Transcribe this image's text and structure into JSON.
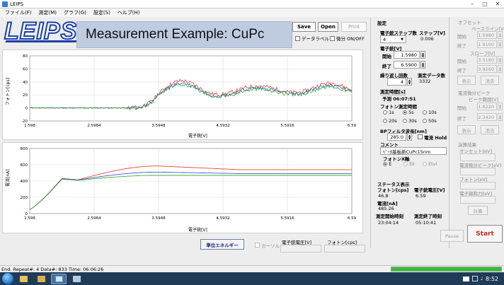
{
  "window": {
    "title": "LEIPS"
  },
  "menu": [
    "ファイル(F)",
    "測定(M)",
    "グラフ(G)",
    "設定(S)",
    "ヘルプ(H)"
  ],
  "logo": "LEIPS",
  "banner": "Measurement Example: CuPc",
  "toolbar": {
    "save": "Save",
    "open": "Open",
    "print": "Print",
    "data_label": "データラベル",
    "derivative": "微分 ON/OFF"
  },
  "upper_plot": {
    "ylabel": "フォトン[cps]",
    "xlabel": "電子銃[V]",
    "yticks": [
      "80",
      "60",
      "40",
      "20",
      "0",
      "-20"
    ],
    "xticks": [
      "1.598",
      "2.5964",
      "3.5948",
      "4.5932",
      "5.5916",
      "6.59"
    ]
  },
  "lower_plot": {
    "ylabel": "電流[nA]",
    "xlabel": "電子銃[V]",
    "yticks": [
      "800",
      "600",
      "400",
      "200",
      "0"
    ],
    "xticks": [
      "1.598",
      "2.5964",
      "3.5948",
      "4.5932",
      "5.5916",
      "6.59"
    ]
  },
  "bottom_bar": {
    "vacuum_button": "準位エネルギー",
    "cursor": "カーソル",
    "egun_voltage": "電子銃電圧[V]",
    "photon": "フォトン[cps]"
  },
  "settings": {
    "header": "設定",
    "egun_steps_label": "電子銃ステップ数",
    "steps_value": "4",
    "step_v_label": "ステップ[V]",
    "step_v_value": "0.006",
    "egun_v_label": "電子銃[V]",
    "start_label": "開始",
    "start_value": "1.5980",
    "end_label": "終了",
    "end_value": "6.5900",
    "repeat_label": "繰り返し回数",
    "repeat_value": "4",
    "data_count_label": "測定データ数",
    "data_count_value": "3332",
    "meas_time_label": "測定時間[s]",
    "forecast_label": "予測 06:07:51",
    "photon_time_label": "フォトン測定時間",
    "times": [
      "1s",
      "5s",
      "10s",
      "20s",
      "30s",
      "50s"
    ],
    "bp_label": "BPフィルタ波長[nm]",
    "bp_value": "285.0",
    "current_hold": "電流 Hold",
    "comment_label": "コメント",
    "comment_value": "ﾍﾟｰﾀ基板新CuPc15nm",
    "photon_x_label": "フォトンX軸",
    "photon_x_options": [
      "E",
      "Ek",
      "Etvl"
    ]
  },
  "status": {
    "header": "ステータス表示",
    "photon_label": "フォトン[cps]",
    "photon_value": "46.8",
    "egun_label": "電子銃電圧[V]",
    "egun_value": "6.59",
    "current_label": "電流[nA]",
    "current_value": "485.26",
    "start_time_label": "測定開始時刻",
    "start_time_value": "23:04:14",
    "end_time_label": "測定終了時刻",
    "end_time_value": "05:10:41"
  },
  "right_panel": {
    "offset_header": "オフセット",
    "baseline_label": "ベースライン[V]",
    "start_label": "開始",
    "end_label": "終了",
    "baseline_start": "1.5980",
    "baseline_end": "1.9100",
    "slope_label": "スロープ[V]",
    "slope_start": "3.5180",
    "slope_end": "3.9260",
    "show": "表示",
    "clear": "消去",
    "peak_header": "電流微分ピーク",
    "peak_range_label": "ピーク範囲[V]",
    "peak_start": "1.6220",
    "peak_end": "2.3420",
    "result_header": "演算結果",
    "onset_label": "オンセット[eV]",
    "peak_result_label": "電流微分ピーク[eV]",
    "photon_ev_label": "フォトン[eV]",
    "affinity_label": "電子親和力[eV]",
    "calc": "計算",
    "pause": "Pause",
    "start": "Start"
  },
  "statusbar": {
    "text": "End. Repeat#: 4 Data#: 833 Time: 06:06:26",
    "progress": 1.0
  },
  "taskbar": {
    "clock": "8:52"
  },
  "colors": {
    "start_button": "#cc2a1e",
    "progress": "#30c030",
    "logo": "#1a3fa8"
  }
}
